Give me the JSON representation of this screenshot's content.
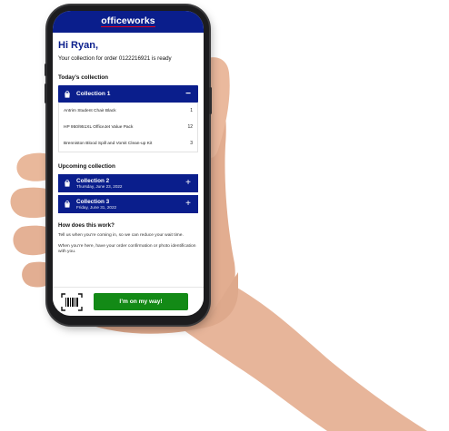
{
  "app": {
    "logo": "officeworks"
  },
  "greeting": "Hi Ryan,",
  "ready_message": "Your collection for order 0122216921 is ready",
  "today": {
    "section_title": "Today’s collection",
    "collection": {
      "name": "Collection 1",
      "toggle": "−",
      "items": [
        {
          "name": "Antrim Student Chair Black",
          "qty": "1"
        },
        {
          "name": "HP 950/951XL OfficeJet Value Pack",
          "qty": "12"
        },
        {
          "name": "Brenniston Blood Spill and Vomit Clean-up Kit",
          "qty": "3"
        }
      ]
    }
  },
  "upcoming": {
    "section_title": "Upcoming collection",
    "collections": [
      {
        "name": "Collection 2",
        "date": "Thursday, June 23, 2022",
        "toggle": "+"
      },
      {
        "name": "Collection 3",
        "date": "Friday, June 31, 2022",
        "toggle": "+"
      }
    ]
  },
  "how": {
    "title": "How does this work?",
    "p1": "Tell us when you’re coming in, so we can reduce your wait time.",
    "p2": "When you’re here, have your order confirmation or photo identification with you."
  },
  "footer": {
    "cta_label": "I’m on my way!"
  },
  "icons": {
    "bag": "shopping-bag-icon",
    "barcode": "barcode-scanner-icon"
  },
  "colors": {
    "brand_blue": "#0a1e8c",
    "brand_red": "#e3001b",
    "cta_green": "#138a16"
  }
}
